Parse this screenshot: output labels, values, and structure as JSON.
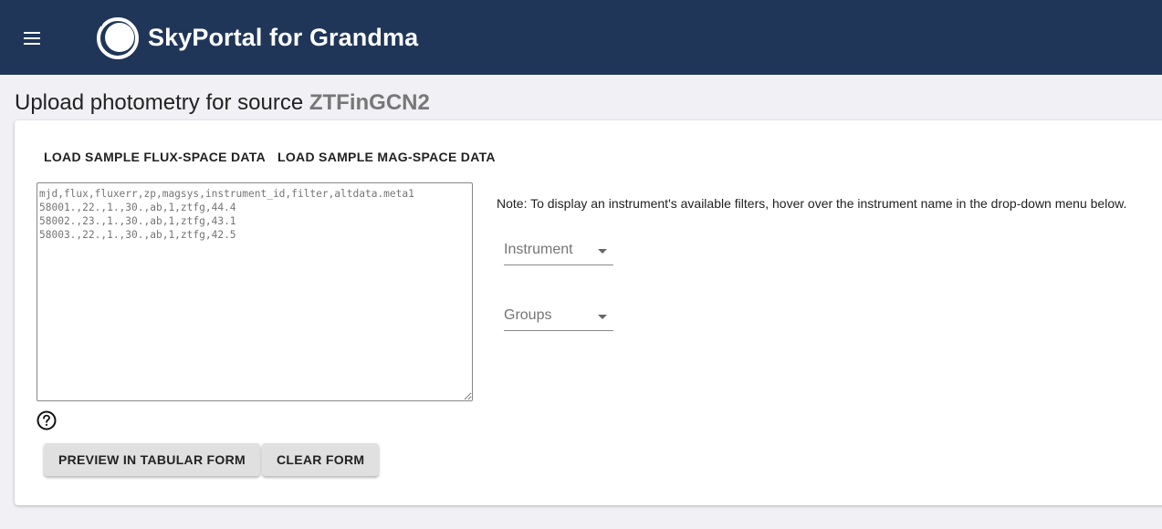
{
  "header": {
    "app_title": "SkyPortal for Grandma",
    "icons": {
      "menu": "menu-icon",
      "logo": "skyportal-logo-icon"
    },
    "background_color": "#1f3659"
  },
  "page": {
    "heading_prefix": "Upload photometry for source",
    "source_name": "ZTFinGCN2"
  },
  "sample_buttons": {
    "flux_label": "LOAD SAMPLE FLUX-SPACE DATA",
    "mag_label": "LOAD SAMPLE MAG-SPACE DATA"
  },
  "csv_input": {
    "placeholder": "mjd,flux,fluxerr,zp,magsys,instrument_id,filter,altdata.meta1\n58001.,22.,1.,30.,ab,1,ztfg,44.4\n58002.,23.,1.,30.,ab,1,ztfg,43.1\n58003.,22.,1.,30.,ab,1,ztfg,42.5",
    "value": ""
  },
  "help": {
    "icon": "help-circle-icon"
  },
  "actions": {
    "preview_label": "PREVIEW IN TABULAR FORM",
    "clear_label": "CLEAR FORM"
  },
  "form": {
    "note": "Note: To display an instrument's available filters, hover over the instrument name in the drop-down menu below.",
    "instrument_label": "Instrument",
    "groups_label": "Groups",
    "dropdown_icon": "arrow-drop-down-icon"
  }
}
